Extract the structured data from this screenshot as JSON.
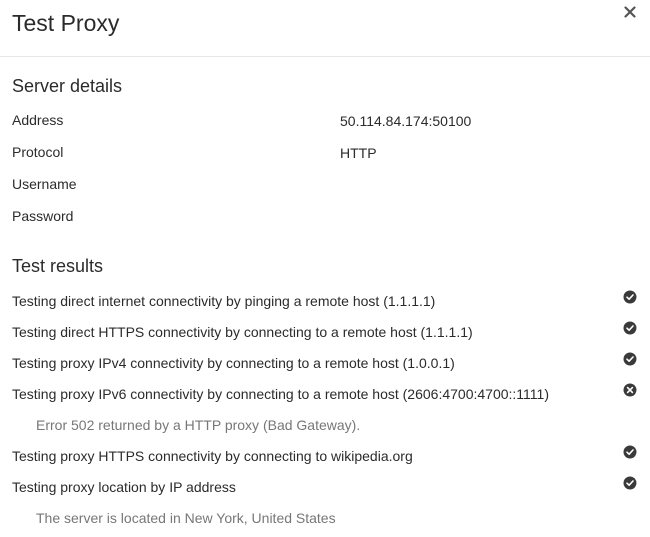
{
  "dialog": {
    "title": "Test Proxy"
  },
  "server": {
    "heading": "Server details",
    "rows": [
      {
        "label": "Address",
        "value": "50.114.84.174:50100"
      },
      {
        "label": "Protocol",
        "value": "HTTP"
      },
      {
        "label": "Username",
        "value": ""
      },
      {
        "label": "Password",
        "value": ""
      }
    ]
  },
  "results": {
    "heading": "Test results",
    "items": [
      {
        "text": "Testing direct internet connectivity by pinging a remote host (1.1.1.1)",
        "status": "success",
        "icon": "check-circle-icon"
      },
      {
        "text": "Testing direct HTTPS connectivity by connecting to a remote host (1.1.1.1)",
        "status": "success",
        "icon": "check-circle-icon"
      },
      {
        "text": "Testing proxy IPv4 connectivity by connecting to a remote host (1.0.0.1)",
        "status": "success",
        "icon": "check-circle-icon"
      },
      {
        "text": "Testing proxy IPv6 connectivity by connecting to a remote host (2606:4700:4700::1111)",
        "status": "error",
        "icon": "x-circle-icon",
        "detail": "Error 502 returned by a HTTP proxy (Bad Gateway)."
      },
      {
        "text": "Testing proxy HTTPS connectivity by connecting to wikipedia.org",
        "status": "success",
        "icon": "check-circle-icon"
      },
      {
        "text": "Testing proxy location by IP address",
        "status": "success",
        "icon": "check-circle-icon",
        "detail": "The server is located in New York, United States"
      }
    ]
  },
  "colors": {
    "text": "#2b2b2b",
    "muted": "#777777",
    "icon": "#3a3a3a",
    "divider": "#e6e6e6"
  },
  "icons": {
    "close": "close-icon"
  }
}
